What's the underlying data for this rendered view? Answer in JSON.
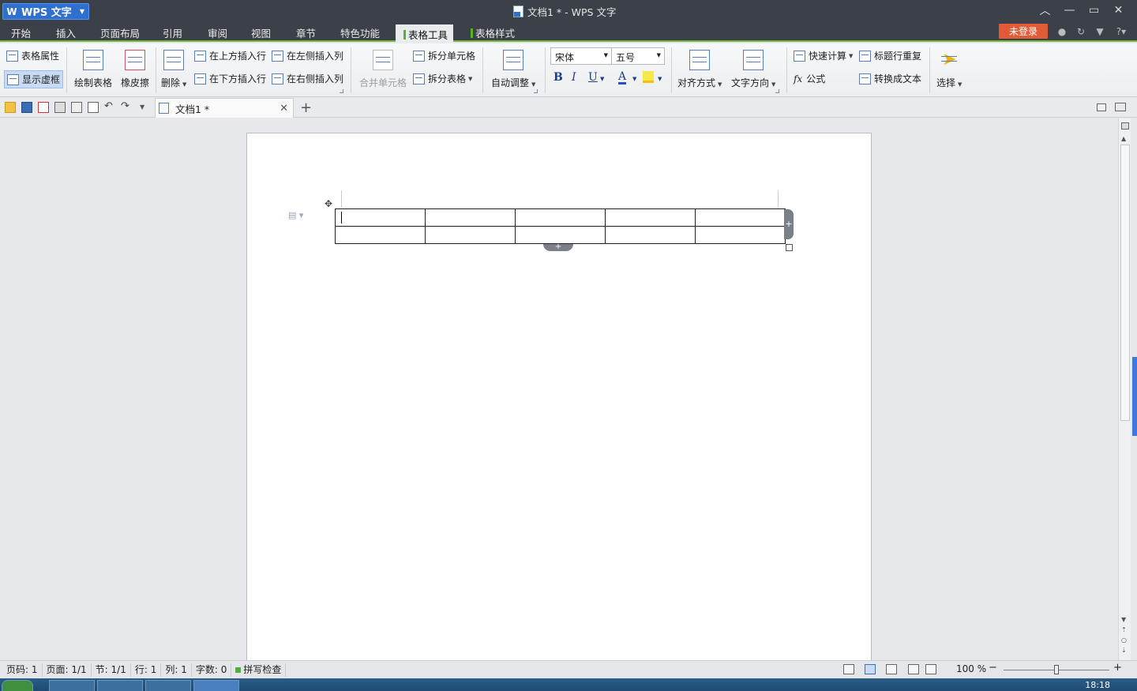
{
  "app": {
    "name": "WPS 文字",
    "doc_title": "文档1 * - WPS 文字"
  },
  "menu": {
    "items": [
      "开始",
      "插入",
      "页面布局",
      "引用",
      "审阅",
      "视图",
      "章节",
      "特色功能",
      "表格工具",
      "表格样式"
    ],
    "active": "表格工具",
    "login": "未登录"
  },
  "ribbon": {
    "table_props": "表格属性",
    "show_gridlines": "显示虚框",
    "draw_table": "绘制表格",
    "eraser": "橡皮擦",
    "delete": "删除",
    "insert_row_above": "在上方插入行",
    "insert_row_below": "在下方插入行",
    "insert_col_left": "在左侧插入列",
    "insert_col_right": "在右侧插入列",
    "merge_cells": "合并单元格",
    "split_cells": "拆分单元格",
    "split_table": "拆分表格",
    "auto_fit": "自动调整",
    "font_name": "宋体",
    "font_size": "五号",
    "bold": "B",
    "italic": "I",
    "underline": "U",
    "font_color": "A",
    "align": "对齐方式",
    "text_direction": "文字方向",
    "quick_calc": "快速计算",
    "formula_fx": "fx",
    "formula": "公式",
    "repeat_header": "标题行重复",
    "to_text": "转换成文本",
    "select": "选择"
  },
  "tabs": {
    "doc_tab": "文档1 *"
  },
  "document": {
    "table": {
      "rows": 2,
      "cols": 5
    }
  },
  "status": {
    "page": "页码: 1",
    "pages": "页面: 1/1",
    "section": "节: 1/1",
    "row": "行: 1",
    "col": "列: 1",
    "words": "字数: 0",
    "spell": "拼写检查",
    "zoom": "100 %"
  },
  "taskbar": {
    "clock": "18:18"
  }
}
